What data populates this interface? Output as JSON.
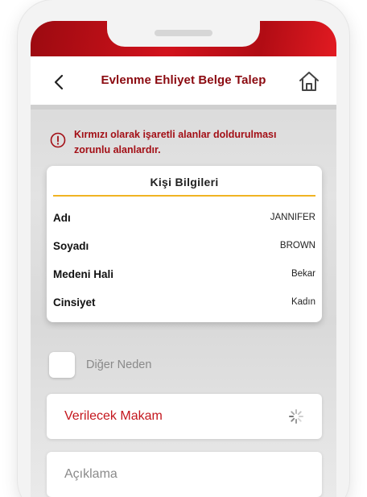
{
  "header": {
    "title": "Evlenme Ehliyet Belge Talep",
    "back_icon": "chevron-left-icon",
    "home_icon": "home-icon"
  },
  "warning": {
    "icon": "info-circle-icon",
    "text_line1": "Kırmızı olarak işaretli alanlar doldurulması",
    "text_line2": "zorunlu alanlardır."
  },
  "person_card": {
    "title": "Kişi Bilgileri",
    "rows": [
      {
        "label": "Adı",
        "value": "JANNIFER"
      },
      {
        "label": "Soyadı",
        "value": "BROWN"
      },
      {
        "label": "Medeni Hali",
        "value": "Bekar"
      },
      {
        "label": "Cinsiyet",
        "value": "Kadın"
      }
    ]
  },
  "other_reason": {
    "label": "Diğer Neden",
    "checked": false
  },
  "authority_field": {
    "label": "Verilecek Makam",
    "loading": true
  },
  "description_field": {
    "placeholder": "Açıklama"
  },
  "colors": {
    "brand_red": "#d2121c",
    "title_dark_red": "#8b0a10",
    "warning_red": "#a30f16",
    "required_label_red": "#c4161d",
    "divider_yellow": "#f0b323",
    "placeholder_gray": "#8a8a8a"
  }
}
